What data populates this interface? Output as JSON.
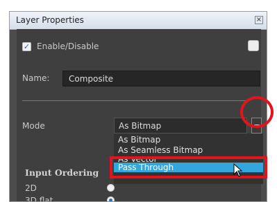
{
  "window": {
    "title": "Layer Properties",
    "close_icon": "close-icon"
  },
  "enable": {
    "label": "Enable/Disable",
    "checked": true
  },
  "name_field": {
    "label": "Name:",
    "value": "Composite"
  },
  "mode": {
    "label": "Mode",
    "selected": "As Bitmap",
    "options": [
      "As Bitmap",
      "As Seamless Bitmap",
      "As Vector",
      "Pass Through"
    ],
    "highlighted": "Pass Through"
  },
  "input_ordering": {
    "heading": "Input Ordering",
    "rows": [
      {
        "label": "2D",
        "selected": false
      },
      {
        "label": "3D flat",
        "selected": true
      }
    ]
  },
  "colors": {
    "panel_bg": "#3f3f3f",
    "highlight": "#34a6de",
    "annotation_red": "#e3141b"
  }
}
